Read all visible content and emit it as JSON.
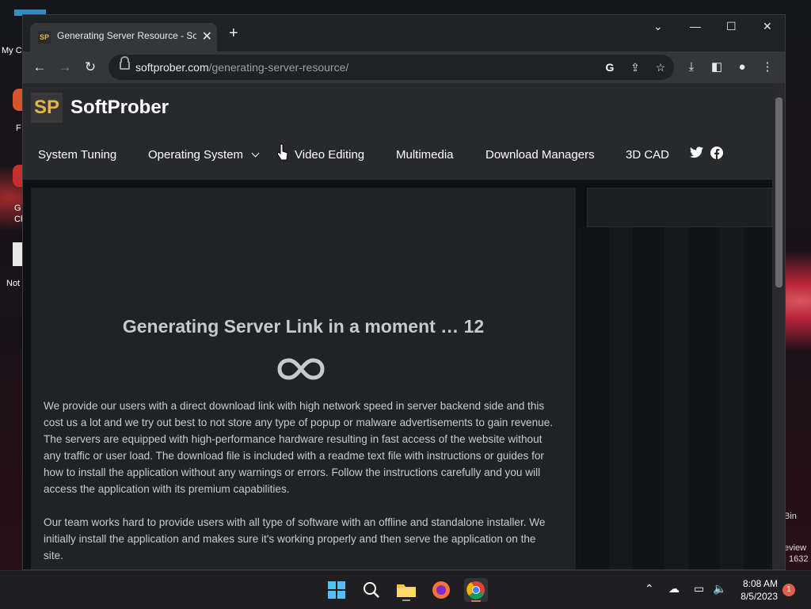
{
  "desktop": {
    "icons": [
      "My C",
      "F",
      "G\nCh",
      "Not"
    ],
    "right_labels": [
      "Bin",
      "eview",
      "1632"
    ]
  },
  "browser": {
    "tab_title": "Generating Server Resource - SoftProber",
    "favicon_text": "SP",
    "url_host": "softprober.com",
    "url_path": "/generating-server-resource/"
  },
  "site": {
    "logo_text": "SP",
    "name": "SoftProber",
    "nav": [
      "System Tuning",
      "Operating System",
      "Video Editing",
      "Multimedia",
      "Download Managers",
      "3D CAD"
    ],
    "heading": "Generating Server Link in a moment … 12",
    "paragraphs": [
      "We provide our users with a direct download link with high network speed in server backend side and this cost us a lot and we try out best to not store any type of popup or malware advertisements to gain revenue. The servers are equipped with high-performance hardware resulting in fast access of the website without any traffic or user load. The download file is included with a readme text file with instructions or guides for how to install the application without any warnings or errors. Follow the instructions carefully and you will access the application with its premium capabilities.",
      "Our team works hard to provide users with all type of software with an offline and standalone installer. We initially install the application and makes sure it's working properly and then serve the application on the site."
    ]
  },
  "taskbar": {
    "time": "8:08 AM",
    "date": "8/5/2023",
    "notification_count": "1"
  },
  "colors": {
    "accent_logo": "#e4b64a",
    "chrome_dark": "#202124",
    "chrome_toolbar": "#35363a"
  }
}
